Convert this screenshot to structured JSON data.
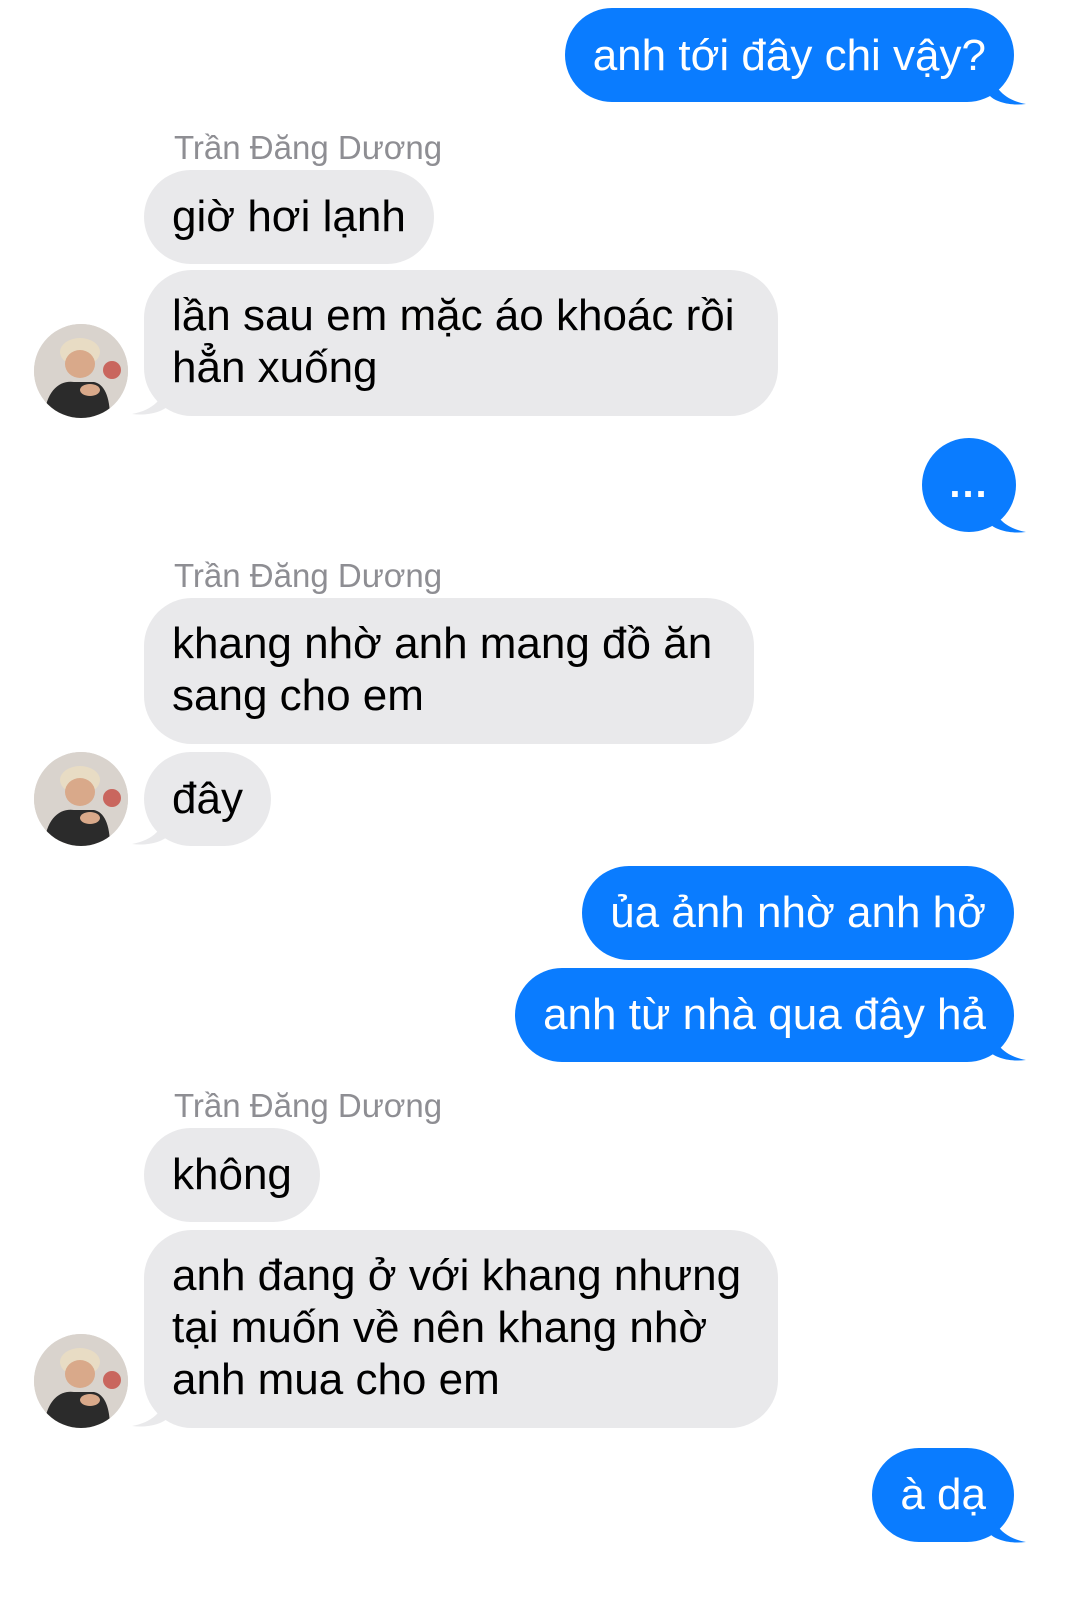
{
  "conversation": {
    "contact_name": "Trần Đăng Dương",
    "messages": [
      {
        "from": "me",
        "text": "anh tới đây chi vậy?"
      },
      {
        "from": "contact",
        "sender_label": "Trần Đăng Dương",
        "text": "giờ hơi lạnh"
      },
      {
        "from": "contact",
        "text": "lần sau em mặc áo khoác rồi\nhẳn xuống"
      },
      {
        "from": "me",
        "text": "..."
      },
      {
        "from": "contact",
        "sender_label": "Trần Đăng Dương",
        "text": "khang nhờ anh mang đồ ăn\nsang cho em"
      },
      {
        "from": "contact",
        "text": "đây"
      },
      {
        "from": "me",
        "text": "ủa ảnh nhờ anh hở"
      },
      {
        "from": "me",
        "text": "anh từ nhà qua đây hả"
      },
      {
        "from": "contact",
        "sender_label": "Trần Đăng Dương",
        "text": "không"
      },
      {
        "from": "contact",
        "text": "anh đang ở với khang nhưng\ntại muốn về nên khang nhờ\nanh mua cho em"
      },
      {
        "from": "me",
        "text": "à dạ"
      }
    ]
  },
  "colors": {
    "outgoing_bubble": "#0a7cff",
    "incoming_bubble": "#e9e9eb",
    "sender_label": "#8e8e93",
    "background": "#ffffff"
  },
  "icons": {
    "avatar": "contact-avatar-photo"
  }
}
